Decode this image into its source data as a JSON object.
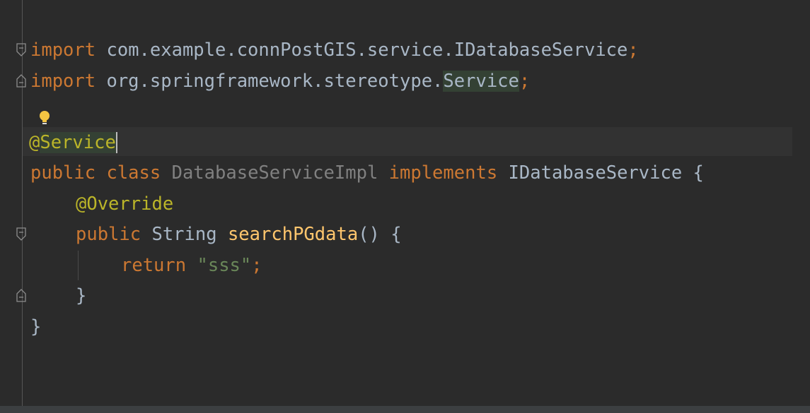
{
  "editor": {
    "lines": {
      "import1": {
        "kw": "import",
        "pkg": " com.example.connPostGIS.service.IDatabaseService",
        "semi": ";"
      },
      "import2": {
        "kw": "import",
        "pkg": " org.springframework.stereotype.",
        "cls": "Service",
        "semi": ";"
      },
      "annotation": {
        "at": "@",
        "name": "Service"
      },
      "classdecl": {
        "kw1": "public",
        "kw2": " class",
        "name": " DatabaseServiceImpl",
        "kw3": " implements",
        "iface": " IDatabaseService {"
      },
      "override": {
        "text": "@Override"
      },
      "method": {
        "kw": "public",
        "type": " String ",
        "name": "searchPGdata",
        "rest": "() {"
      },
      "ret": {
        "kw": "return",
        "space": " ",
        "str": "\"sss\"",
        "semi": ";"
      },
      "close_method": {
        "text": "}"
      },
      "close_class": {
        "text": "}"
      }
    },
    "icons": [
      "fold-icon",
      "lightbulb-icon"
    ]
  }
}
